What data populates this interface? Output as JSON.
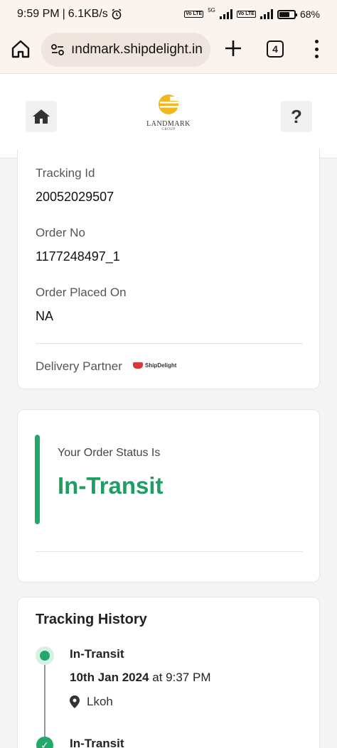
{
  "statusbar": {
    "time": "9:59 PM",
    "speed": "6.1KB/s",
    "network": "5G",
    "volte": "Vo LTE",
    "battery": "68%",
    "battery_level": 0.68
  },
  "browser": {
    "url": "ındmark.shipdelight.in",
    "tab_count": "4"
  },
  "header": {
    "brand_name": "LANDMARK",
    "brand_sub": "GROUP",
    "help_label": "?"
  },
  "details": {
    "tracking_id_label": "Tracking Id",
    "tracking_id": "20052029507",
    "order_no_label": "Order No",
    "order_no": "1177248497_1",
    "order_placed_label": "Order Placed On",
    "order_placed": "NA",
    "delivery_partner_label": "Delivery Partner",
    "delivery_partner_logo": "ShipDelight"
  },
  "status": {
    "label": "Your Order Status Is",
    "value": "In-Transit",
    "accent_color": "#22a86b"
  },
  "history": {
    "title": "Tracking History",
    "events": [
      {
        "status": "In-Transit",
        "date": "10th Jan 2024",
        "at": "at",
        "time": "9:37 PM",
        "location": "Lkoh"
      },
      {
        "status": "In-Transit"
      }
    ]
  }
}
